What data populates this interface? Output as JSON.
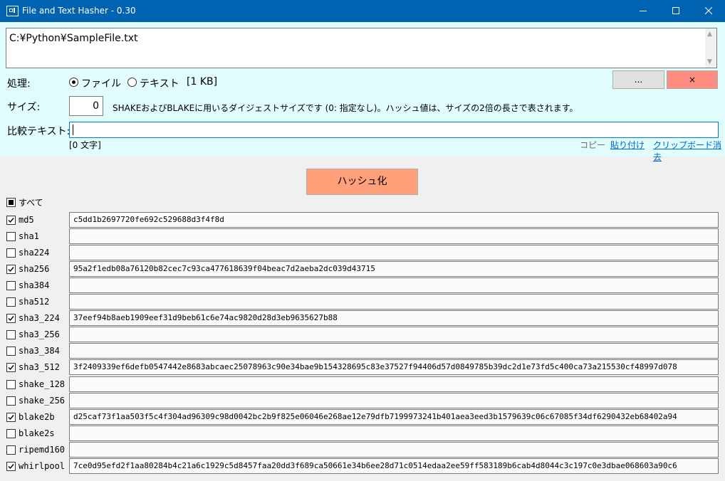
{
  "window": {
    "title": "File and Text Hasher - 0.30"
  },
  "path": {
    "value": "C:¥Python¥SampleFile.txt"
  },
  "process": {
    "label": "処理:",
    "file_option": "ファイル",
    "text_option": "テキスト",
    "selected": "ファイル",
    "size_info": "[1 KB]"
  },
  "buttons": {
    "browse": "...",
    "clear": "×",
    "hash": "ハッシュ化"
  },
  "colors": {
    "accent": "#ffa07a",
    "panel": "#e1fcfc",
    "titlebar": "#0063b1"
  },
  "size": {
    "label": "サイズ:",
    "value": "0",
    "description": "SHAKEおよびBLAKEに用いるダイジェストサイズです (0: 指定なし)。ハッシュ値は、サイズの2倍の長さで表されます。"
  },
  "compare": {
    "label": "比較テキスト:",
    "value": "",
    "char_count": "[0 文字]",
    "copy": "コピー",
    "paste": "貼り付け",
    "clear_clipboard": "クリップボード消去"
  },
  "select_all": {
    "label": "すべて",
    "state": "partial"
  },
  "algorithms": [
    {
      "name": "md5",
      "checked": true,
      "hash": "c5dd1b2697720fe692c529688d3f4f8d"
    },
    {
      "name": "sha1",
      "checked": false,
      "hash": ""
    },
    {
      "name": "sha224",
      "checked": false,
      "hash": ""
    },
    {
      "name": "sha256",
      "checked": true,
      "hash": "95a2f1edb08a76120b82cec7c93ca477618639f04beac7d2aeba2dc039d43715"
    },
    {
      "name": "sha384",
      "checked": false,
      "hash": ""
    },
    {
      "name": "sha512",
      "checked": false,
      "hash": ""
    },
    {
      "name": "sha3_224",
      "checked": true,
      "hash": "37eef94b8aeb1909eef31d9beb61c6e74ac9820d28d3eb9635627b88"
    },
    {
      "name": "sha3_256",
      "checked": false,
      "hash": ""
    },
    {
      "name": "sha3_384",
      "checked": false,
      "hash": ""
    },
    {
      "name": "sha3_512",
      "checked": true,
      "hash": "3f2409339ef6defb0547442e8683abcaec25078963c90e34bae9b154328695c83e37527f94406d57d0849785b39dc2d1e73fd5c400ca73a215530cf48997d078"
    },
    {
      "name": "shake_128",
      "checked": false,
      "hash": ""
    },
    {
      "name": "shake_256",
      "checked": false,
      "hash": ""
    },
    {
      "name": "blake2b",
      "checked": true,
      "hash": "d25caf73f1aa503f5c4f304ad96309c98d0042bc2b9f825e06046e268ae12e79dfb7199973241b401aea3eed3b1579639c06c67085f34df6290432eb68402a94"
    },
    {
      "name": "blake2s",
      "checked": false,
      "hash": ""
    },
    {
      "name": "ripemd160",
      "checked": false,
      "hash": ""
    },
    {
      "name": "whirlpool",
      "checked": true,
      "hash": "7ce0d95efd2f1aa80284b4c21a6c1929c5d8457faa20dd3f689ca50661e34b6ee28d71c0514edaa2ee59ff583189b6cab4d8044c3c197c0e3dbae068603a90c6"
    }
  ]
}
